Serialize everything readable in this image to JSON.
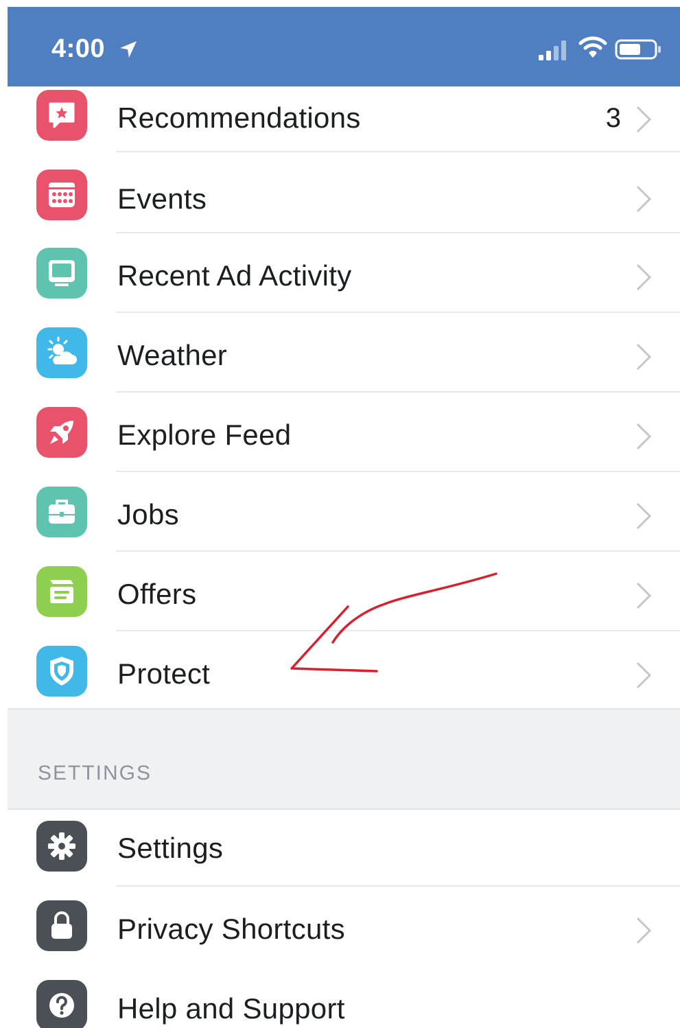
{
  "status_bar": {
    "time": "4:00",
    "icons": [
      "location-arrow-icon",
      "cellular-signal-icon",
      "wifi-icon",
      "battery-icon"
    ]
  },
  "menu": {
    "items": [
      {
        "label": "Recommendations",
        "badge": "3",
        "icon": "recommendations-icon",
        "icon_color": "#e8536b"
      },
      {
        "label": "Events",
        "badge": "",
        "icon": "calendar-icon",
        "icon_color": "#e8536b"
      },
      {
        "label": "Recent Ad Activity",
        "badge": "",
        "icon": "monitor-icon",
        "icon_color": "#5ec4b0"
      },
      {
        "label": "Weather",
        "badge": "",
        "icon": "weather-icon",
        "icon_color": "#40b9e8"
      },
      {
        "label": "Explore Feed",
        "badge": "",
        "icon": "rocket-icon",
        "icon_color": "#e8536b"
      },
      {
        "label": "Jobs",
        "badge": "",
        "icon": "briefcase-icon",
        "icon_color": "#5ec4b0"
      },
      {
        "label": "Offers",
        "badge": "",
        "icon": "offers-tag-icon",
        "icon_color": "#8fcf4f"
      },
      {
        "label": "Protect",
        "badge": "",
        "icon": "shield-icon",
        "icon_color": "#40b9e8"
      }
    ]
  },
  "settings_section": {
    "header": "SETTINGS",
    "items": [
      {
        "label": "Settings",
        "icon": "gear-icon",
        "icon_color": "#4b4f56"
      },
      {
        "label": "Privacy Shortcuts",
        "icon": "lock-icon",
        "icon_color": "#4b4f56"
      },
      {
        "label": "Help and Support",
        "icon": "help-question-icon",
        "icon_color": "#4b4f56"
      }
    ]
  },
  "colors": {
    "status_bar_bg": "#4f7fc0",
    "annotation_arrow": "#d9202f",
    "divider": "#e8e9eb",
    "section_bg": "#f0f1f3"
  }
}
